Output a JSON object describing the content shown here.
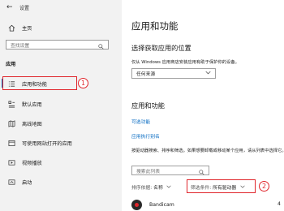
{
  "window": {
    "title": "设置"
  },
  "sidebar": {
    "home_label": "主页",
    "search_placeholder": "查找设置",
    "section_label": "应用",
    "items": [
      {
        "label": "应用和功能",
        "icon": "apps-list-icon",
        "selected": true
      },
      {
        "label": "默认应用",
        "icon": "default-apps-icon"
      },
      {
        "label": "离线地图",
        "icon": "offline-map-icon"
      },
      {
        "label": "可使用网站打开的应用",
        "icon": "web-open-icon"
      },
      {
        "label": "视频播放",
        "icon": "video-playback-icon"
      },
      {
        "label": "启动",
        "icon": "startup-icon"
      }
    ]
  },
  "main": {
    "title": "应用和功能",
    "install_heading": "选择获取应用的位置",
    "install_desc": "仅从 Windows 应用商店安装应用有助于保护你的设备。",
    "install_source": "任何来源",
    "apps_heading": "应用和功能",
    "optional_features_link": "可选功能",
    "app_aliases_link": "应用执行别名",
    "list_desc": "按驱动器搜索、排序和筛选。如果想要卸载或移动某个应用，请从列表中选择它。",
    "list_search_placeholder": "搜索此列表",
    "sort_label": "排序依据:",
    "sort_value": "名称",
    "filter_label": "筛选条件:",
    "filter_value": "所有驱动器",
    "apps": [
      {
        "name": "Bandicam",
        "size": "4"
      }
    ]
  },
  "annotations": {
    "badge1": "1",
    "badge2": "2"
  },
  "colors": {
    "accent": "#0067c0",
    "annotation": "#e0262c",
    "sidebar_bg": "#f2f2f2"
  }
}
